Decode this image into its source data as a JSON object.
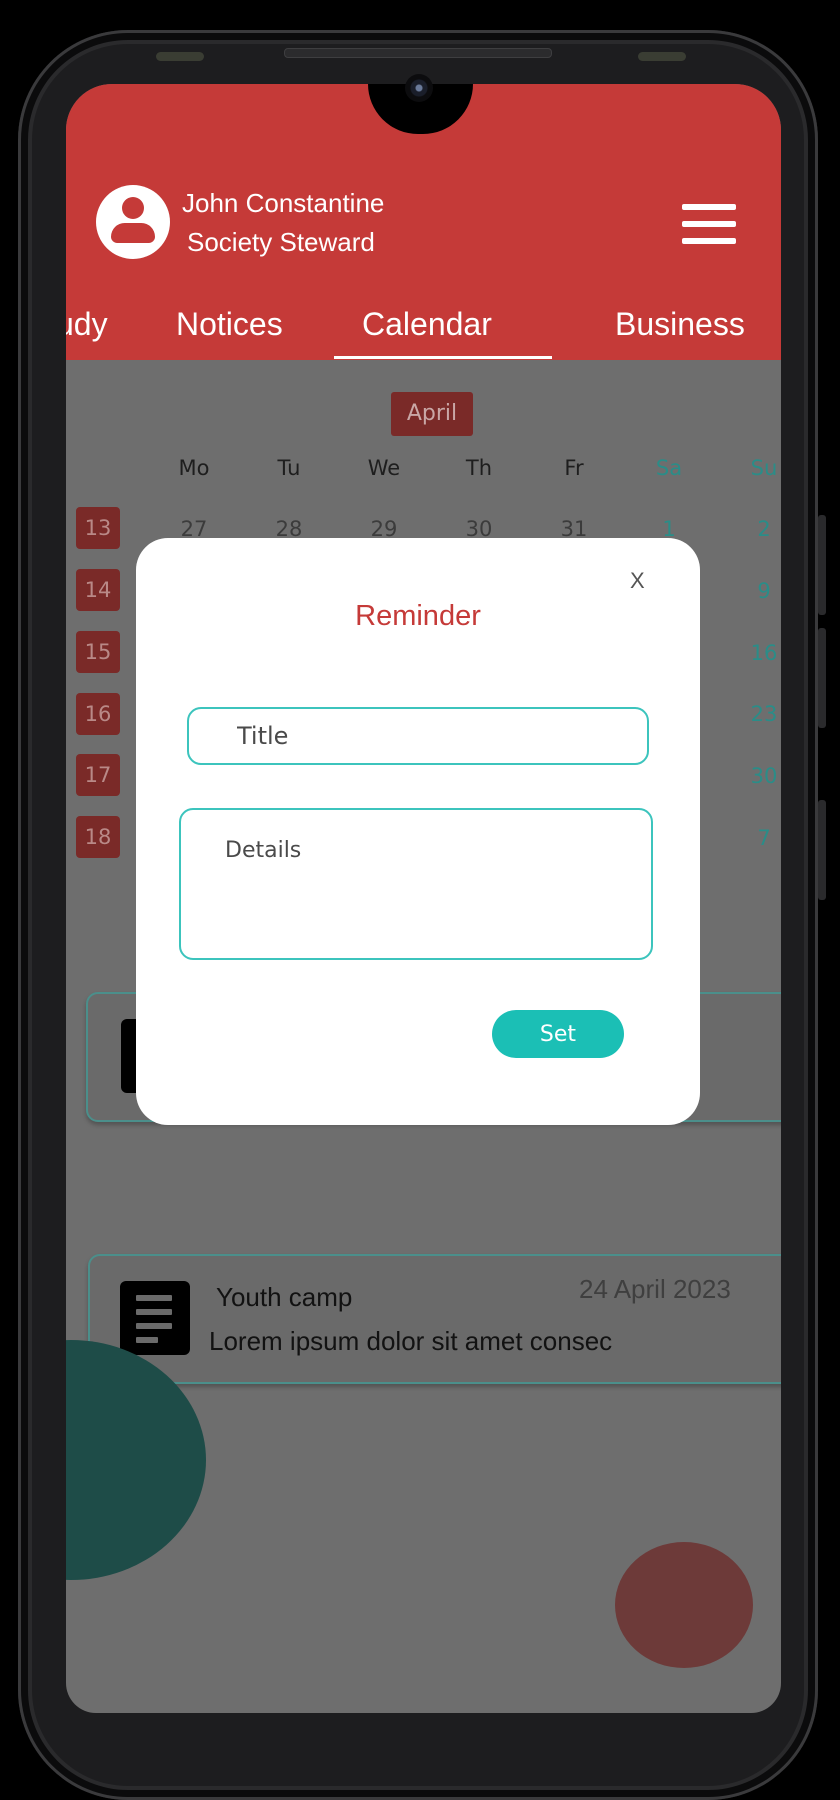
{
  "user": {
    "name": "John Constantine",
    "role": "Society Steward",
    "avatar_icon": "user-circle-icon"
  },
  "header": {
    "menu_icon": "hamburger-menu-icon",
    "accent_color": "#c53a38"
  },
  "tabs": [
    {
      "label": "udy",
      "active": false
    },
    {
      "label": "Notices",
      "active": false
    },
    {
      "label": "Calendar",
      "active": true
    },
    {
      "label": "Business",
      "active": false
    }
  ],
  "calendar": {
    "month": "April",
    "weekdays": [
      "Mo",
      "Tu",
      "We",
      "Th",
      "Fr",
      "Sa",
      "Su"
    ],
    "weeks": [
      {
        "num": "13",
        "days": [
          "27",
          "28",
          "29",
          "30",
          "31",
          "1",
          "2"
        ]
      },
      {
        "num": "14",
        "days": [
          "",
          "",
          "",
          "",
          "",
          "",
          "9"
        ]
      },
      {
        "num": "15",
        "days": [
          "",
          "",
          "",
          "",
          "",
          "",
          "16"
        ]
      },
      {
        "num": "16",
        "days": [
          "",
          "",
          "",
          "",
          "",
          "",
          "23"
        ]
      },
      {
        "num": "17",
        "days": [
          "",
          "",
          "",
          "",
          "",
          "",
          "30"
        ]
      },
      {
        "num": "18",
        "days": [
          "",
          "",
          "",
          "",
          "",
          "",
          "7"
        ]
      }
    ]
  },
  "events": [
    {
      "title": "Youth camp",
      "date": "24 April 2023",
      "body": "Lorem ipsum dolor sit amet consec",
      "icon": "document-icon"
    }
  ],
  "modal": {
    "close_label": "X",
    "title": "Reminder",
    "title_placeholder": "Title",
    "details_placeholder": "Details",
    "set_label": "Set",
    "button_color": "#1bbfb5",
    "field_border_color": "#3cc4bd"
  }
}
